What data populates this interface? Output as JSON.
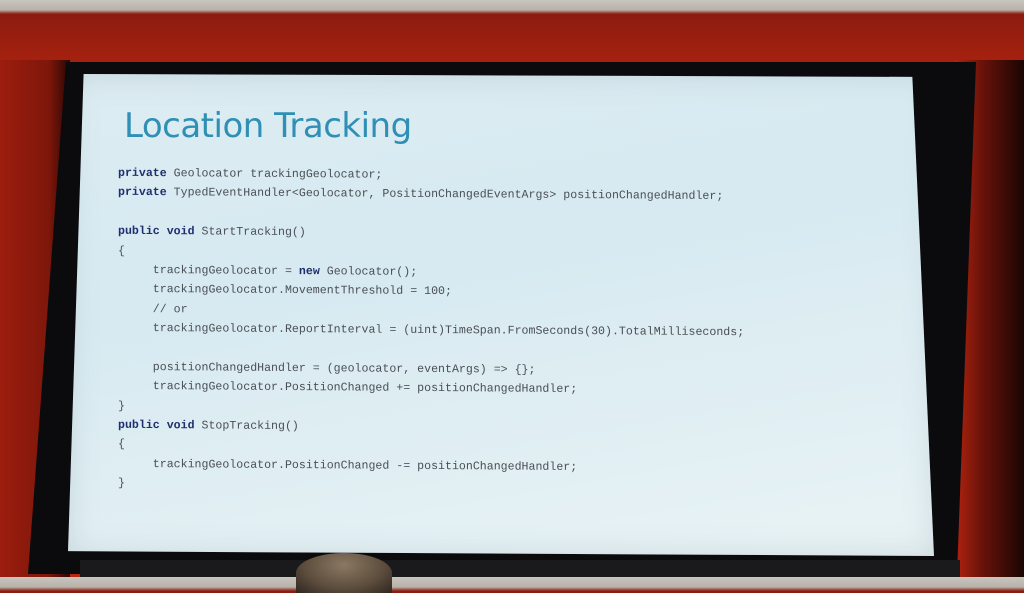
{
  "slide": {
    "title": "Location Tracking",
    "code_lines": [
      [
        {
          "t": "private",
          "k": true
        },
        {
          "t": " Geolocator trackingGeolocator;"
        }
      ],
      [
        {
          "t": "private",
          "k": true
        },
        {
          "t": " TypedEventHandler<Geolocator, PositionChangedEventArgs> positionChangedHandler;"
        }
      ],
      [],
      [
        {
          "t": "public void",
          "k": true
        },
        {
          "t": " StartTracking()"
        }
      ],
      [
        {
          "t": "{"
        }
      ],
      [
        {
          "t": "     trackingGeolocator = "
        },
        {
          "t": "new",
          "k": true
        },
        {
          "t": " Geolocator();"
        }
      ],
      [
        {
          "t": "     trackingGeolocator.MovementThreshold = 100;"
        }
      ],
      [
        {
          "t": "     // or"
        }
      ],
      [
        {
          "t": "     trackingGeolocator.ReportInterval = (uint)TimeSpan.FromSeconds(30).TotalMilliseconds;"
        }
      ],
      [],
      [
        {
          "t": "     positionChangedHandler = (geolocator, eventArgs) => {};"
        }
      ],
      [
        {
          "t": "     trackingGeolocator.PositionChanged += positionChangedHandler;"
        }
      ],
      [
        {
          "t": "}"
        }
      ],
      [
        {
          "t": "public void",
          "k": true
        },
        {
          "t": " StopTracking()"
        }
      ],
      [
        {
          "t": "{"
        }
      ],
      [
        {
          "t": "     trackingGeolocator.PositionChanged -= positionChangedHandler;"
        }
      ],
      [
        {
          "t": "}"
        }
      ]
    ]
  },
  "colors": {
    "title": "#2f8fb5",
    "keyword": "#1f2f6e",
    "code_text": "#4a4f55",
    "screen": "#dcecf2",
    "wall": "#a5210f"
  }
}
